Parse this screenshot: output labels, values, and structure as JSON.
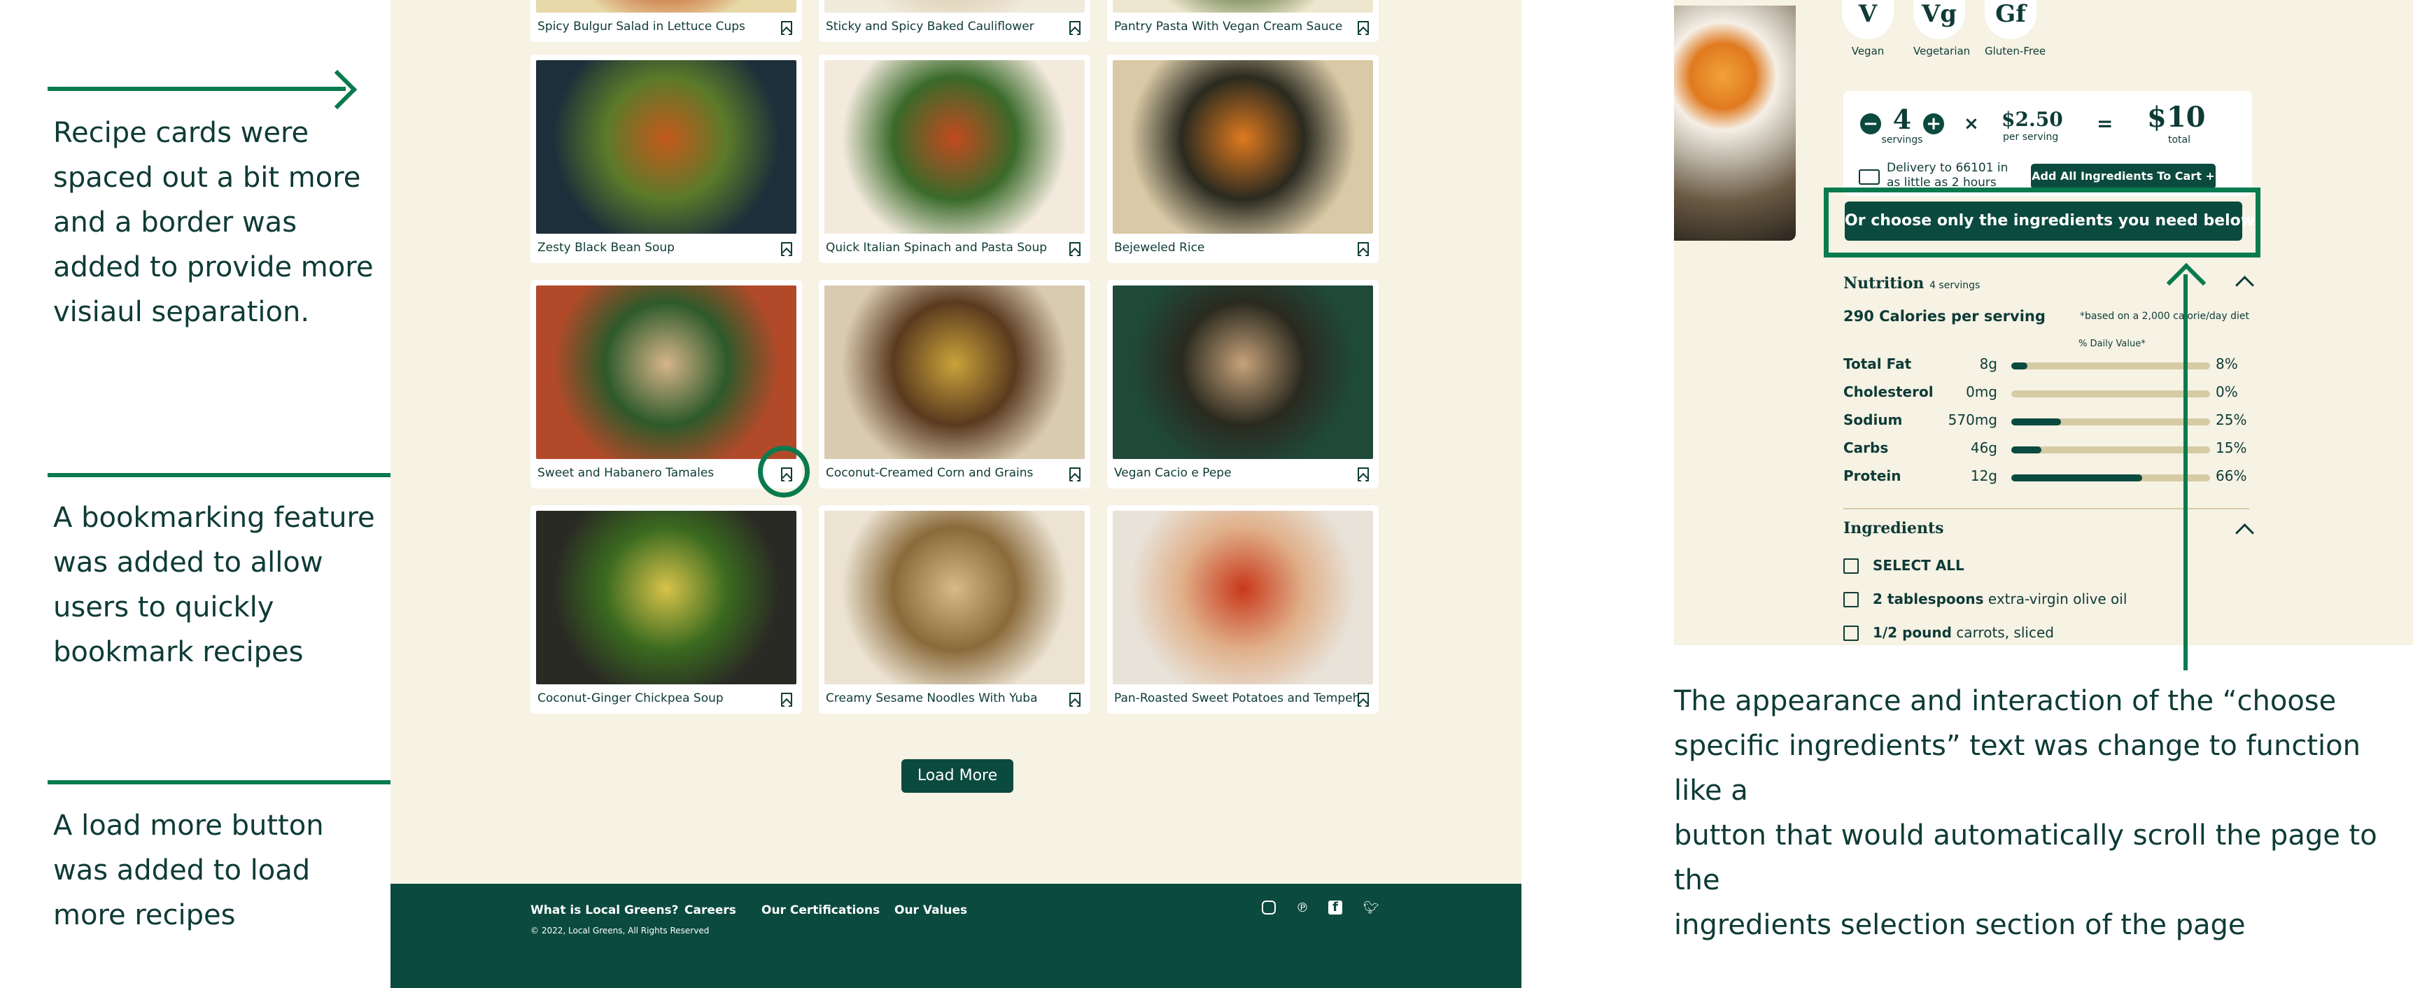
{
  "annotations": {
    "cards_note": "Recipe cards were\nspaced out a bit more\nand a border was\nadded to provide more\nvisiaul separation.",
    "bookmark_note": "A bookmarking feature\nwas added to allow\nusers to quickly\nbookmark recipes",
    "loadmore_note": "A load more button\nwas added to load\nmore recipes",
    "choose_note": "The appearance and interaction of the “choose\nspecific ingredients” text was change to function like a\nbutton that would automatically scroll the page to the\ningredients selection section of the page"
  },
  "recipes": [
    {
      "title": "Spicy Bulgur Salad in Lettuce Cups"
    },
    {
      "title": "Sticky and Spicy Baked Cauliflower"
    },
    {
      "title": "Pantry Pasta With Vegan Cream Sauce"
    },
    {
      "title": "Zesty Black Bean Soup"
    },
    {
      "title": "Quick Italian Spinach and Pasta Soup"
    },
    {
      "title": "Bejeweled Rice"
    },
    {
      "title": "Sweet and Habanero Tamales"
    },
    {
      "title": "Coconut-Creamed Corn and Grains"
    },
    {
      "title": "Vegan Cacio e Pepe"
    },
    {
      "title": "Coconut-Ginger Chickpea Soup"
    },
    {
      "title": "Creamy Sesame Noodles With Yuba"
    },
    {
      "title": "Pan-Roasted Sweet Potatoes and Tempeh"
    }
  ],
  "load_more_label": "Load More",
  "footer": {
    "nav": [
      "What is Local Greens?",
      "Careers",
      "Our Certifications",
      "Our Values"
    ],
    "copyright": "© 2022, Local Greens, All Rights Reserved",
    "social_icons": [
      "instagram-icon",
      "pinterest-icon",
      "facebook-icon",
      "twitter-icon"
    ]
  },
  "detail": {
    "diets": [
      {
        "badge": "V",
        "label": "Vegan"
      },
      {
        "badge": "Vg",
        "label": "Vegetarian"
      },
      {
        "badge": "Gf",
        "label": "Gluten-Free"
      }
    ],
    "servings": "4",
    "servings_label": "servings",
    "price": "$2.50",
    "price_label": "per serving",
    "total": "$10",
    "total_label": "total",
    "delivery": "Delivery to 66101 in as little as 2 hours",
    "add_all_label": "Add All Ingredients To Cart",
    "choose_label": "Or choose only the ingredients you need below",
    "nutrition_title": "Nutrition",
    "nutrition_servings": "4 servings",
    "calories": "290 Calories per serving",
    "calorie_note": "*based on a 2,000 calorie/day diet",
    "daily_value_label": "% Daily Value*",
    "nutrients": [
      {
        "name": "Total Fat",
        "amount": "8g",
        "pct": "8%",
        "fraction": 0.08
      },
      {
        "name": "Cholesterol",
        "amount": "0mg",
        "pct": "0%",
        "fraction": 0.0
      },
      {
        "name": "Sodium",
        "amount": "570mg",
        "pct": "25%",
        "fraction": 0.25
      },
      {
        "name": "Carbs",
        "amount": "46g",
        "pct": "15%",
        "fraction": 0.15
      },
      {
        "name": "Protein",
        "amount": "12g",
        "pct": "66%",
        "fraction": 0.66
      }
    ],
    "ingredients_title": "Ingredients",
    "select_all": "SELECT ALL",
    "ingredients": [
      {
        "qty": "2 tablespoons",
        "name": "extra-virgin olive oil"
      },
      {
        "qty": "1/2 pound",
        "name": "carrots, sliced"
      }
    ]
  },
  "colors": {
    "brand": "#0b4a3e",
    "accent": "#0a7a4f",
    "background": "#f6f2e4"
  }
}
